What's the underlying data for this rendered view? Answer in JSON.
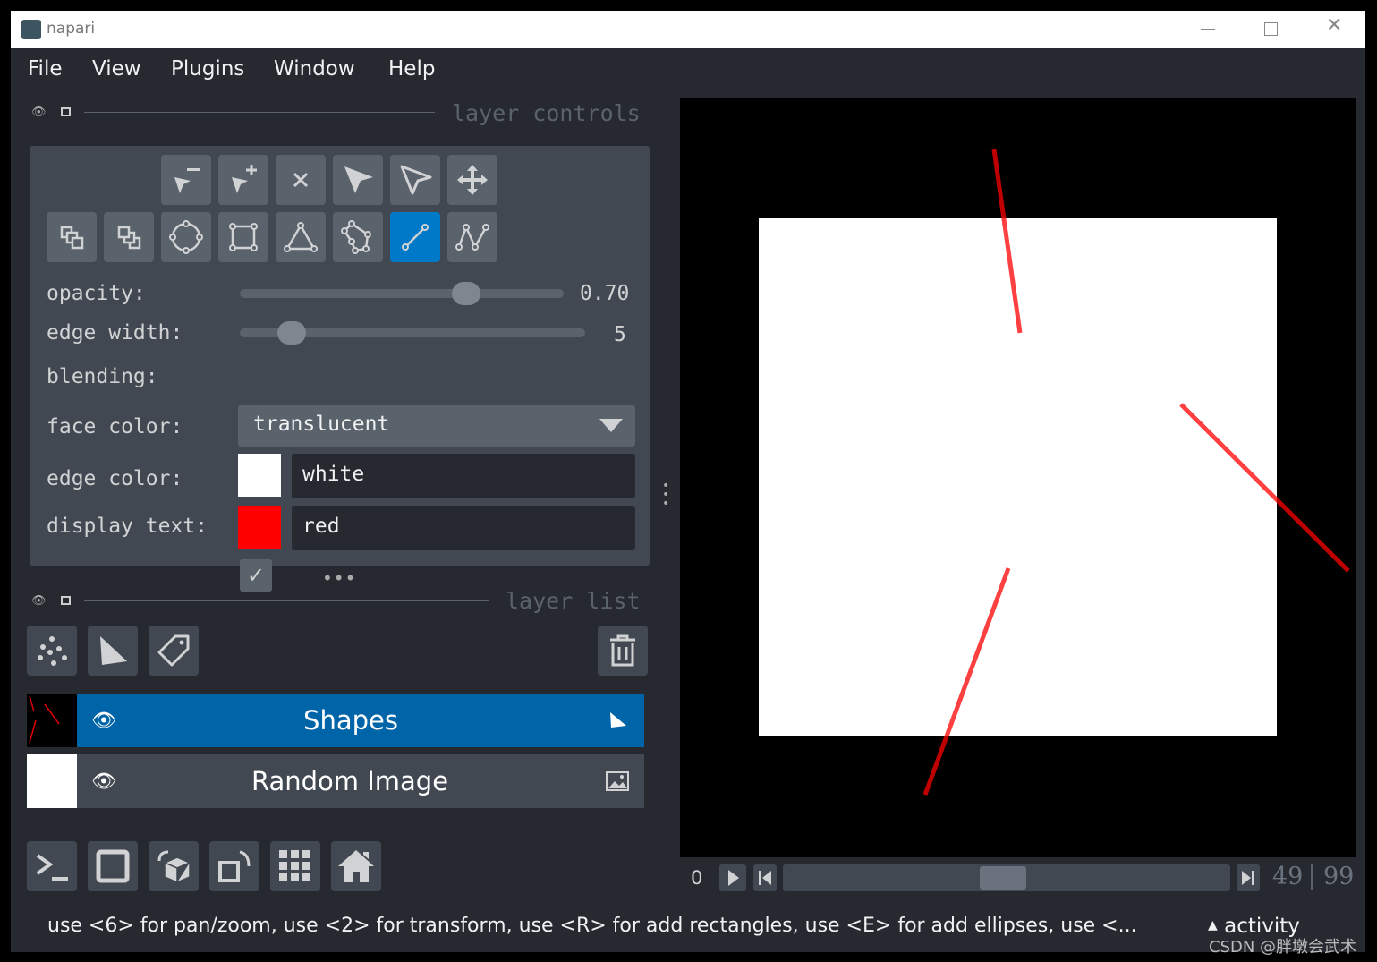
{
  "window": {
    "title": "napari"
  },
  "menu": [
    "File",
    "View",
    "Plugins",
    "Window",
    "Help"
  ],
  "layer_controls": {
    "header": "layer controls",
    "tools_row1": [
      "remove-selected",
      "add-vertex",
      "remove-vertex",
      "select",
      "direct-select",
      "pan-zoom"
    ],
    "tools_row2": [
      "move-back",
      "move-front",
      "ellipse",
      "rectangle",
      "triangle-polygon",
      "polygon",
      "line",
      "path"
    ],
    "active_tool": "line",
    "opacity": {
      "label": "opacity:",
      "value": "0.70",
      "fraction": 0.7
    },
    "edge_width": {
      "label": "edge width:",
      "value": "5",
      "fraction": 0.15
    },
    "blending": {
      "label": "blending:",
      "value": "translucent"
    },
    "face_color": {
      "label": "face color:",
      "value": "white",
      "swatch": "#ffffff"
    },
    "edge_color": {
      "label": "edge color:",
      "value": "red",
      "swatch": "#ff0000"
    },
    "display_text": {
      "label": "display text:",
      "checked": true
    }
  },
  "layer_list": {
    "header": "layer list",
    "layers": [
      {
        "name": "Shapes",
        "selected": true,
        "visible": true,
        "type": "shapes"
      },
      {
        "name": "Random Image",
        "selected": false,
        "visible": true,
        "type": "image"
      }
    ]
  },
  "dims": {
    "start": "0",
    "current": "49",
    "max": "99",
    "fraction": 0.49
  },
  "status": {
    "text": "use <6> for pan/zoom, use <2> for transform, use <R> for add rectangles, use <E> for add ellipses, use <...",
    "activity": "activity"
  },
  "watermark": "CSDN @胖墩会武术",
  "colors": {
    "accent": "#0079c9",
    "panel": "#414851",
    "background": "#262930",
    "edge": "#ff0000"
  }
}
